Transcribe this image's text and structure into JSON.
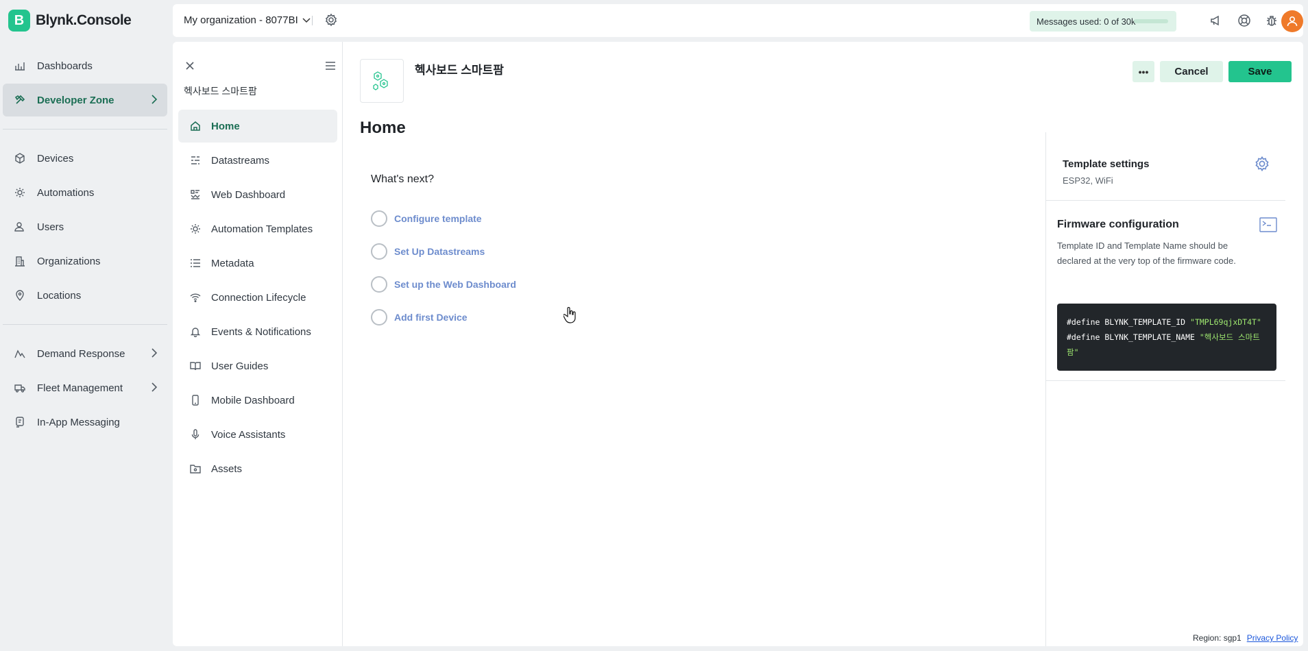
{
  "brand": {
    "logo_letter": "B",
    "name": "Blynk.Console",
    "accent": "#23c48e"
  },
  "sidebar": {
    "items": [
      {
        "label": "Dashboards",
        "icon": "dashboard-icon"
      },
      {
        "label": "Developer Zone",
        "icon": "tools-icon",
        "active": true,
        "has_chevron": true
      },
      {
        "label": "Devices",
        "icon": "cube-icon"
      },
      {
        "label": "Automations",
        "icon": "sun-icon"
      },
      {
        "label": "Users",
        "icon": "users-icon"
      },
      {
        "label": "Organizations",
        "icon": "building-icon"
      },
      {
        "label": "Locations",
        "icon": "pin-icon"
      },
      {
        "label": "Demand Response",
        "icon": "graph-icon",
        "has_chevron": true
      },
      {
        "label": "Fleet Management",
        "icon": "truck-icon",
        "has_chevron": true
      },
      {
        "label": "In-App Messaging",
        "icon": "message-icon"
      }
    ]
  },
  "topbar": {
    "org_name": "My organization - 8077BI",
    "messages_label": "Messages used: 0 of 30k",
    "messages_fraction": 0
  },
  "template": {
    "title": "헥사보드 스마트팜",
    "name": "헥사보드 스마트팜",
    "more_label": "•••",
    "cancel_label": "Cancel",
    "save_label": "Save"
  },
  "subnav": {
    "items": [
      {
        "label": "Home",
        "icon": "home-icon",
        "active": true
      },
      {
        "label": "Datastreams",
        "icon": "datastreams-icon"
      },
      {
        "label": "Web Dashboard",
        "icon": "web-dashboard-icon"
      },
      {
        "label": "Automation Templates",
        "icon": "automation-icon"
      },
      {
        "label": "Metadata",
        "icon": "list-icon"
      },
      {
        "label": "Connection Lifecycle",
        "icon": "wifi-icon"
      },
      {
        "label": "Events & Notifications",
        "icon": "bell-icon"
      },
      {
        "label": "User Guides",
        "icon": "book-icon"
      },
      {
        "label": "Mobile Dashboard",
        "icon": "mobile-icon"
      },
      {
        "label": "Voice Assistants",
        "icon": "mic-icon"
      },
      {
        "label": "Assets",
        "icon": "folder-icon"
      }
    ]
  },
  "main": {
    "page_title": "Home",
    "whats_next": "What's next?",
    "steps": [
      "Configure template",
      "Set Up Datastreams",
      "Set up the Web Dashboard",
      "Add first Device"
    ]
  },
  "template_settings": {
    "title": "Template settings",
    "subtitle": "ESP32, WiFi"
  },
  "firmware": {
    "title": "Firmware configuration",
    "description": "Template ID and Template Name should be declared at the very top of the firmware code.",
    "code": {
      "line1_kw": "#define BLYNK_TEMPLATE_ID ",
      "line1_val": "\"TMPL69qjxDT4T\"",
      "line2_kw": "#define BLYNK_TEMPLATE_NAME ",
      "line2_val": "\"헥사보드 스마트팜\""
    }
  },
  "footer": {
    "region": "Region: sgp1",
    "privacy": "Privacy Policy"
  }
}
